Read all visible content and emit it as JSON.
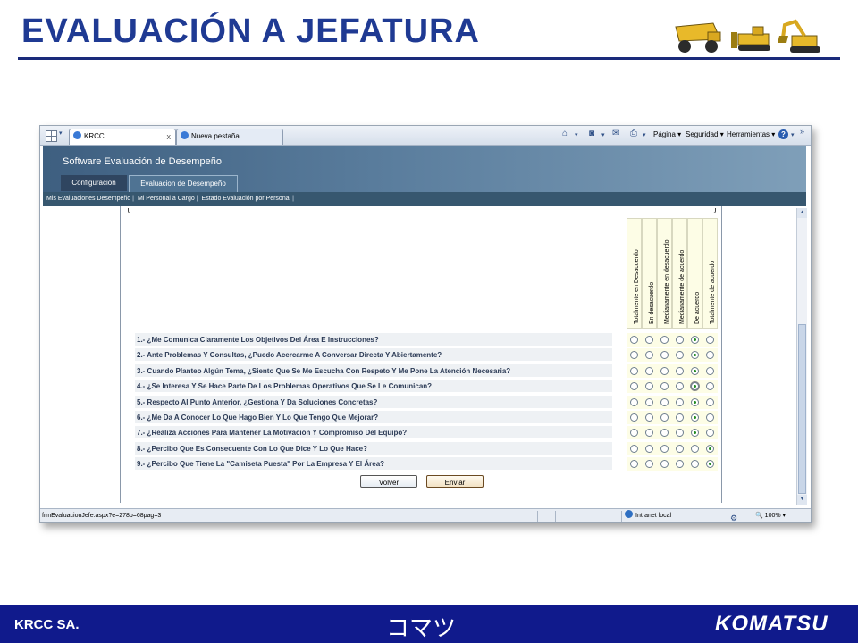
{
  "slide": {
    "title": "EVALUACIÓN A JEFATURA",
    "footer_left": "KRCC SA.",
    "footer_kana": "コマツ",
    "footer_logo": "KOMATSU",
    "colors": {
      "title": "#1f3a93",
      "footer": "#101a8c"
    }
  },
  "browser": {
    "tabs": [
      {
        "label": "KRCC",
        "close": "x"
      },
      {
        "label": "Nueva pestaña"
      }
    ],
    "commands": {
      "page": "Página",
      "security": "Seguridad",
      "tools": "Herramientas"
    },
    "status": {
      "url": "frmEvaluacionJefe.aspx?e=278p=68pag=3",
      "zone": "Intranet local",
      "zoom": "100%"
    }
  },
  "app": {
    "title": "Software Evaluación de Desempeño",
    "tabs": [
      "Configuración",
      "Evaluacion de Desempeño"
    ],
    "menu": [
      "Mis Evaluaciones Desempeño",
      "Mi Personal a Cargo",
      "Estado Evaluación por Personal"
    ]
  },
  "scale": [
    "Totalmente en Desacuerdo",
    "En desacuerdo",
    "Medianamente en desacuerdo",
    "Medianamente de acuerdo",
    "De acuerdo",
    "Totalmente de acuerdo"
  ],
  "questions": [
    {
      "text": "1.- ¿Me Comunica Claramente Los Objetivos Del Área E Instrucciones?",
      "selected": 4
    },
    {
      "text": "2.- Ante Problemas Y Consultas, ¿Puedo Acercarme A Conversar Directa Y Abiertamente?",
      "selected": 4
    },
    {
      "text": "3.- Cuando Planteo Algún Tema, ¿Siento Que Se Me Escucha Con Respeto Y Me Pone La Atención Necesaria?",
      "selected": 4
    },
    {
      "text": "4.- ¿Se Interesa Y Se Hace Parte De Los Problemas Operativos Que Se Le Comunican?",
      "selected": 4
    },
    {
      "text": "5.- Respecto Al Punto Anterior, ¿Gestiona Y Da Soluciones Concretas?",
      "selected": 4
    },
    {
      "text": "6.- ¿Me Da A Conocer Lo Que Hago Bien Y Lo Que Tengo Que Mejorar?",
      "selected": 4
    },
    {
      "text": "7.- ¿Realiza Acciones Para Mantener La Motivación Y Compromiso Del Equipo?",
      "selected": 4
    },
    {
      "text": "8.- ¿Percibo Que Es Consecuente Con Lo Que Dice Y Lo Que Hace?",
      "selected": 5
    },
    {
      "text": "9.- ¿Percibo Que Tiene La \"Camiseta Puesta\" Por La Empresa Y El Área?",
      "selected": 5
    }
  ],
  "buttons": {
    "back": "Volver",
    "send": "Enviar"
  }
}
